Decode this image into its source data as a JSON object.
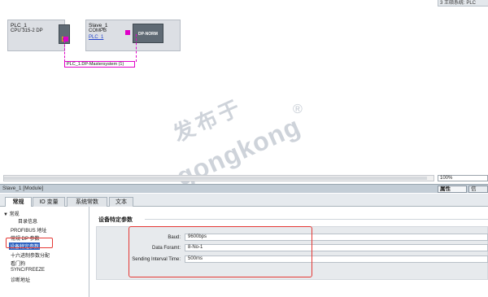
{
  "topbar": {
    "label": "3 王硕系统: PLC"
  },
  "devices": {
    "plc": {
      "name": "PLC_1",
      "type": "CPU 315-2 DP"
    },
    "slave": {
      "name": "Slave_1",
      "type": "COMPB",
      "link": "PLC_1",
      "module_label": "DP-NORM"
    }
  },
  "bus": {
    "label": "PLC_1.DP-Mastersystem (1)",
    "color": "#e000c8"
  },
  "watermark": {
    "line1": "发布于",
    "line2": "gongkong",
    "mark": "®"
  },
  "zoom": {
    "value": "100%"
  },
  "inspector": {
    "title": "Slave_1 [Module]",
    "properties_tab": "属性",
    "info_tab": "信",
    "tabs": [
      "常规",
      "IO 变量",
      "系统常数",
      "文本"
    ],
    "nav": [
      "▼ 常规",
      "目录信息",
      "PROFIBUS 地址",
      "常规 DP 参数",
      "设备特定参数",
      "十六进制参数分配",
      "看门狗",
      "SYNC/FREEZE",
      "诊断地址"
    ],
    "section_title": "设备特定参数",
    "params": [
      {
        "label": "Baud:",
        "value": "9600bps"
      },
      {
        "label": "Data Foramt:",
        "value": "8-No-1"
      },
      {
        "label": "Sending Interval Time:",
        "value": "500ms"
      }
    ]
  },
  "colors": {
    "highlight": "#e53935",
    "selection": "#2a5fbf",
    "accent": "#e000c8"
  }
}
